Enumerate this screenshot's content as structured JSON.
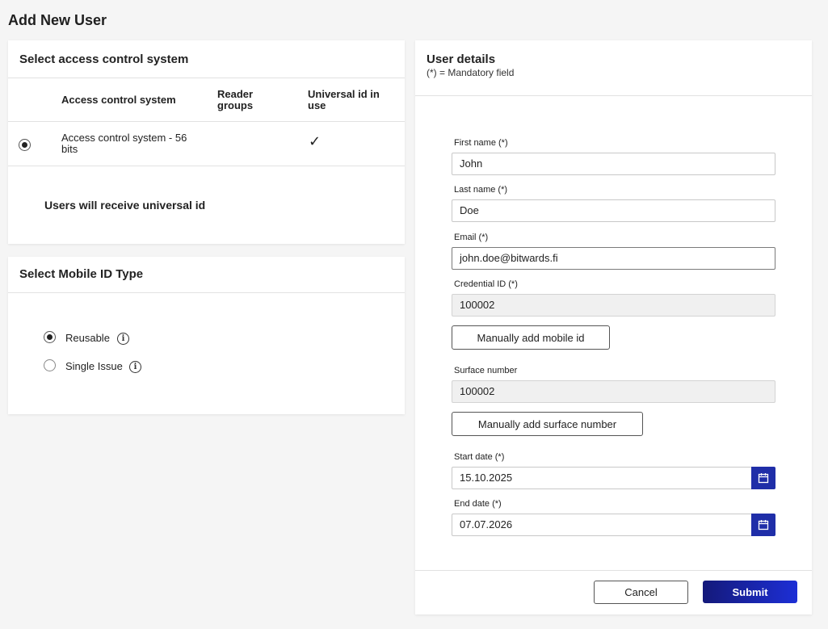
{
  "page": {
    "title": "Add New User"
  },
  "access_control": {
    "title": "Select access control system",
    "columns": [
      "Access control system",
      "Reader groups",
      "Universal id in use"
    ],
    "rows": [
      {
        "selected": true,
        "system": "Access control system - 56 bits",
        "reader_groups": "",
        "universal_id": "✓"
      }
    ],
    "note": "Users will receive universal id"
  },
  "mobile_id": {
    "title": "Select Mobile ID Type",
    "options": [
      {
        "label": "Reusable",
        "selected": true,
        "icon": "info-icon"
      },
      {
        "label": "Single Issue",
        "selected": false,
        "icon": "info-icon"
      }
    ]
  },
  "user_details": {
    "title": "User details",
    "subtitle": "(*) = Mandatory field",
    "fields": {
      "first_name": {
        "label": "First name (*)",
        "value": "John"
      },
      "last_name": {
        "label": "Last name (*)",
        "value": "Doe"
      },
      "email": {
        "label": "Email (*)",
        "value": "john.doe@bitwards.fi"
      },
      "credential_id": {
        "label": "Credential ID (*)",
        "value": "100002"
      },
      "surface_number": {
        "label": "Surface number",
        "value": "100002"
      },
      "start_date": {
        "label": "Start date (*)",
        "value": "15.10.2025"
      },
      "end_date": {
        "label": "End date (*)",
        "value": "07.07.2026"
      }
    },
    "buttons": {
      "add_mobile_id": "Manually add mobile id",
      "add_surface_number": "Manually add surface number",
      "cancel": "Cancel",
      "submit": "Submit"
    }
  },
  "colors": {
    "accent": "#1f2ea8",
    "submit_gradient_start": "#14197a",
    "submit_gradient_end": "#1d2fd6"
  }
}
